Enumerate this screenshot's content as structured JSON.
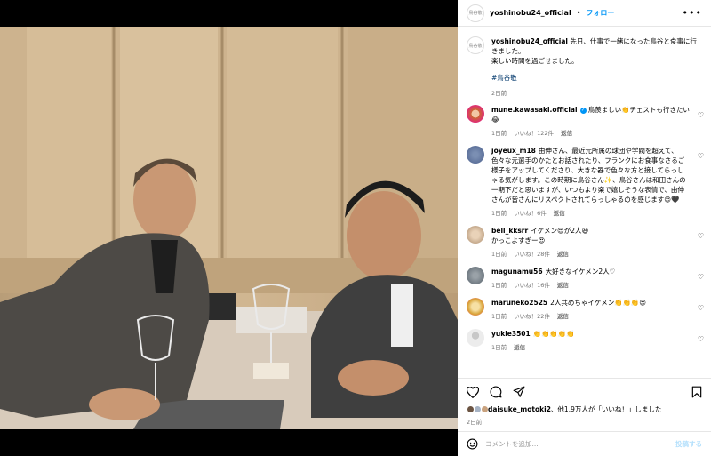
{
  "header": {
    "avatar_text": "鳥谷敬",
    "username": "yoshinobu24_official",
    "separator": "•",
    "follow_label": "フォロー",
    "more_label": "•••"
  },
  "caption": {
    "username": "yoshinobu24_official",
    "text": "先日、仕事で一緒になった鳥谷と食事に行きました。",
    "text2": "楽しい時間を過ごせました。",
    "hashtag": "#鳥谷敬",
    "time": "2日前"
  },
  "comments": [
    {
      "user": "mune.kawasaki.official",
      "text": "鳥羨ましい👏チェストも行きたい😂",
      "time": "1日前",
      "likes": "いいね！122件",
      "reply": "返信",
      "verified": true
    },
    {
      "user": "joyeux_m18",
      "text": "由伸さん、最近元所属の球団や学閥を超えて、色々な元選手のかたとお話されたり、フランクにお食事なさるご様子をアップしてくださり、大きな器で色々な方と接してらっしゃる気がします。この時期に鳥谷さん✨、鳥谷さんは和田さんの一期下だと思いますが、いつもより楽で嬉しそうな表情で、由伸さんが皆さんにリスペクトされてらっしゃるのを感じます😍🖤",
      "time": "1日前",
      "likes": "いいね！6件",
      "reply": "返信"
    },
    {
      "user": "bell_kksrr",
      "text": "イケメン😍が2人😆",
      "text2": "かっこよすぎー😍",
      "time": "1日前",
      "likes": "いいね！28件",
      "reply": "返信"
    },
    {
      "user": "magunamu56",
      "text": "大好きなイケメン2人♡",
      "time": "1日前",
      "likes": "いいね！16件",
      "reply": "返信"
    },
    {
      "user": "maruneko2525",
      "text": "2人共めちゃイケメン👏👏👏😍",
      "time": "1日前",
      "likes": "いいね！22件",
      "reply": "返信"
    },
    {
      "user": "yukie3501",
      "text": "👏👏👏👏👏",
      "time": "1日前",
      "reply": "返信"
    }
  ],
  "likes_line": {
    "user": "daisuke_motoki2",
    "rest": "、他1.9万人が「いいね！」しました",
    "time": "2日前"
  },
  "comment_box": {
    "placeholder": "コメントを追加...",
    "post_label": "投稿する"
  },
  "colors": {
    "link_blue": "#0095f6",
    "post_disabled": "#b2dffc",
    "hashtag": "#00376b"
  }
}
